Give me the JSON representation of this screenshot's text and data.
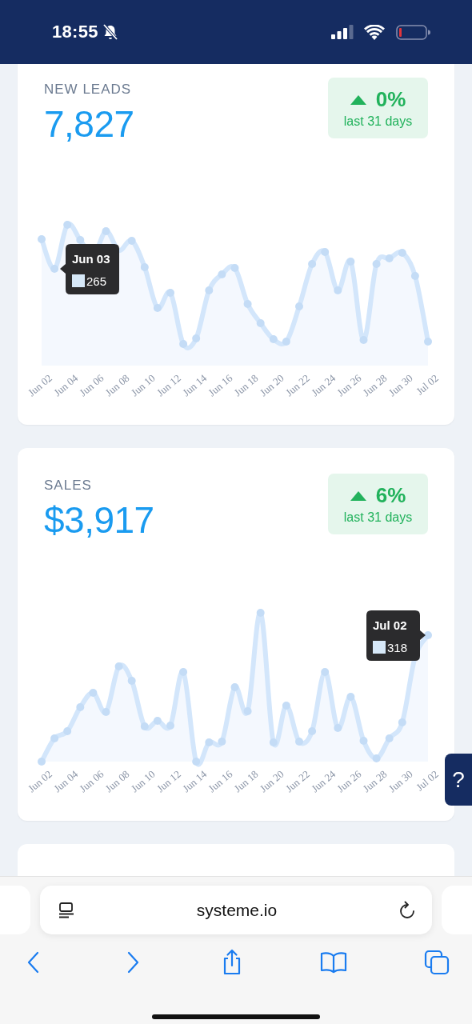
{
  "status_bar": {
    "time": "18:55"
  },
  "cards": [
    {
      "title": "NEW LEADS",
      "value": "7,827",
      "change": {
        "rising": true,
        "percent": "0%",
        "period": "last 31 days"
      },
      "chart": {
        "x_labels": [
          "Jun 02",
          "Jun 04",
          "Jun 06",
          "Jun 08",
          "Jun 10",
          "Jun 12",
          "Jun 14",
          "Jun 16",
          "Jun 18",
          "Jun 20",
          "Jun 22",
          "Jun 24",
          "Jun 26",
          "Jun 28",
          "Jun 30",
          "Jul 02"
        ],
        "tooltip": {
          "title": "Jun 03",
          "value": "265"
        }
      }
    },
    {
      "title": "SALES",
      "value": "$3,917",
      "change": {
        "rising": true,
        "percent": "6%",
        "period": "last 31 days"
      },
      "chart": {
        "x_labels": [
          "Jun 02",
          "Jun 04",
          "Jun 06",
          "Jun 08",
          "Jun 10",
          "Jun 12",
          "Jun 14",
          "Jun 16",
          "Jun 18",
          "Jun 20",
          "Jun 22",
          "Jun 24",
          "Jun 26",
          "Jun 28",
          "Jun 30",
          "Jul 02"
        ],
        "tooltip": {
          "title": "Jul 02",
          "value": "318"
        }
      }
    }
  ],
  "help_button": {
    "label": "?"
  },
  "browser": {
    "url": "systeme.io"
  }
}
